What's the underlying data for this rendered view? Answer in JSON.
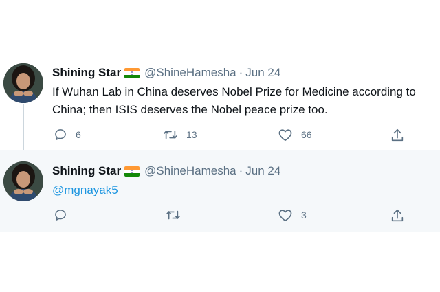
{
  "tweets": [
    {
      "display_name": "Shining Star",
      "handle": "@ShineHamesha",
      "separator": "·",
      "date": "Jun 24",
      "text_line1": "If Wuhan Lab in China deserves Nobel Prize for Medicine according to",
      "text_line2": "China; then ISIS deserves the Nobel peace prize too.",
      "replies": "6",
      "retweets": "13",
      "likes": "66"
    },
    {
      "display_name": "Shining Star",
      "handle": "@ShineHamesha",
      "separator": "·",
      "date": "Jun 24",
      "mention": "@mgnayak5",
      "replies": "",
      "retweets": "",
      "likes": "3"
    }
  ],
  "colors": {
    "secondary_text": "#5b7083",
    "link": "#1b95e0",
    "reply_background": "#f5f8fa",
    "thread_line": "#ccd6dd"
  },
  "icons": [
    "reply-icon",
    "retweet-icon",
    "like-icon",
    "share-icon",
    "india-flag-icon"
  ]
}
